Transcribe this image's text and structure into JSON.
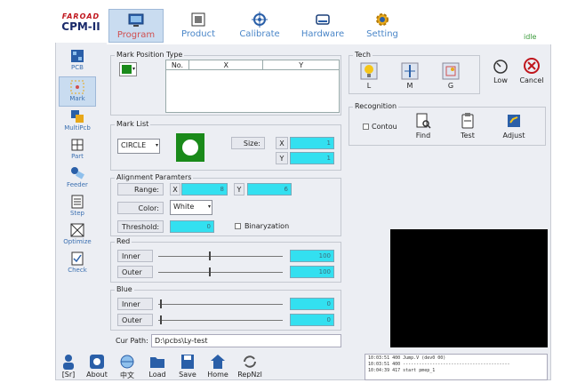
{
  "logo": {
    "brand": "FAROAD",
    "model": "CPM-II"
  },
  "tabs": [
    {
      "label": "Program",
      "icon": "monitor-icon",
      "active": true
    },
    {
      "label": "Product",
      "icon": "board-icon"
    },
    {
      "label": "Calibrate",
      "icon": "crosshair-icon"
    },
    {
      "label": "Hardware",
      "icon": "drive-icon"
    },
    {
      "label": "Setting",
      "icon": "gear-icon"
    }
  ],
  "status": "idle",
  "sidebar": [
    {
      "label": "PCB",
      "icon": "pcb-icon"
    },
    {
      "label": "Mark",
      "icon": "mark-icon",
      "active": true
    },
    {
      "label": "MultiPcb",
      "icon": "multipcb-icon"
    },
    {
      "label": "Part",
      "icon": "part-icon"
    },
    {
      "label": "Feeder",
      "icon": "feeder-icon"
    },
    {
      "label": "Step",
      "icon": "step-icon"
    },
    {
      "label": "Optimize",
      "icon": "optimize-icon"
    },
    {
      "label": "Check",
      "icon": "check-icon"
    }
  ],
  "mark_position": {
    "title": "Mark Position Type",
    "columns": [
      "No.",
      "X",
      "Y"
    ]
  },
  "mark_list": {
    "title": "Mark List",
    "shape": "CIRCLE",
    "size_label": "Size:",
    "x_label": "X",
    "x_value": "1",
    "y_label": "Y",
    "y_value": "1"
  },
  "alignment": {
    "title": "Alignment Paramters",
    "range_label": "Range:",
    "x_label": "X",
    "x_value": "8",
    "y_label": "Y",
    "y_value": "6",
    "color_label": "Color:",
    "color_value": "White",
    "threshold_label": "Threshold:",
    "threshold_value": "0",
    "binarization_label": "Binaryzation"
  },
  "red": {
    "title": "Red",
    "inner_label": "Inner",
    "inner_value": "100",
    "outer_label": "Outer",
    "outer_value": "100"
  },
  "blue": {
    "title": "Blue",
    "inner_label": "Inner",
    "inner_value": "0",
    "outer_label": "Outer",
    "outer_value": "0"
  },
  "cur_path": {
    "label": "Cur Path:",
    "value": "D:\\pcbs\\Ly-test"
  },
  "tech": {
    "title": "Tech",
    "items": [
      {
        "label": "L"
      },
      {
        "label": "M"
      },
      {
        "label": "G"
      }
    ],
    "low_label": "Low",
    "cancel_label": "Cancel"
  },
  "recognition": {
    "title": "Recognition",
    "continue_label": "Contou",
    "find_label": "Find",
    "test_label": "Test",
    "adjust_label": "Adjust"
  },
  "bottom_buttons": [
    {
      "label": "[Sr]",
      "icon": "user-icon"
    },
    {
      "label": "About",
      "icon": "about-icon"
    },
    {
      "label": "中文",
      "icon": "globe-icon"
    },
    {
      "label": "Load",
      "icon": "folder-icon"
    },
    {
      "label": "Save",
      "icon": "save-icon"
    },
    {
      "label": "Home",
      "icon": "home-icon"
    },
    {
      "label": "RepNzl",
      "icon": "refresh-icon"
    }
  ],
  "log_lines": [
    "10:03:51 400 Jump.V (dev0 00)",
    "10:03:51 400 ----------------------------------------",
    "10:04:39 417 start pmep_1"
  ],
  "colors": {
    "accent": "#4a86c8",
    "cyan_field": "#33e0f0",
    "mark_green": "#1a8a1a"
  }
}
